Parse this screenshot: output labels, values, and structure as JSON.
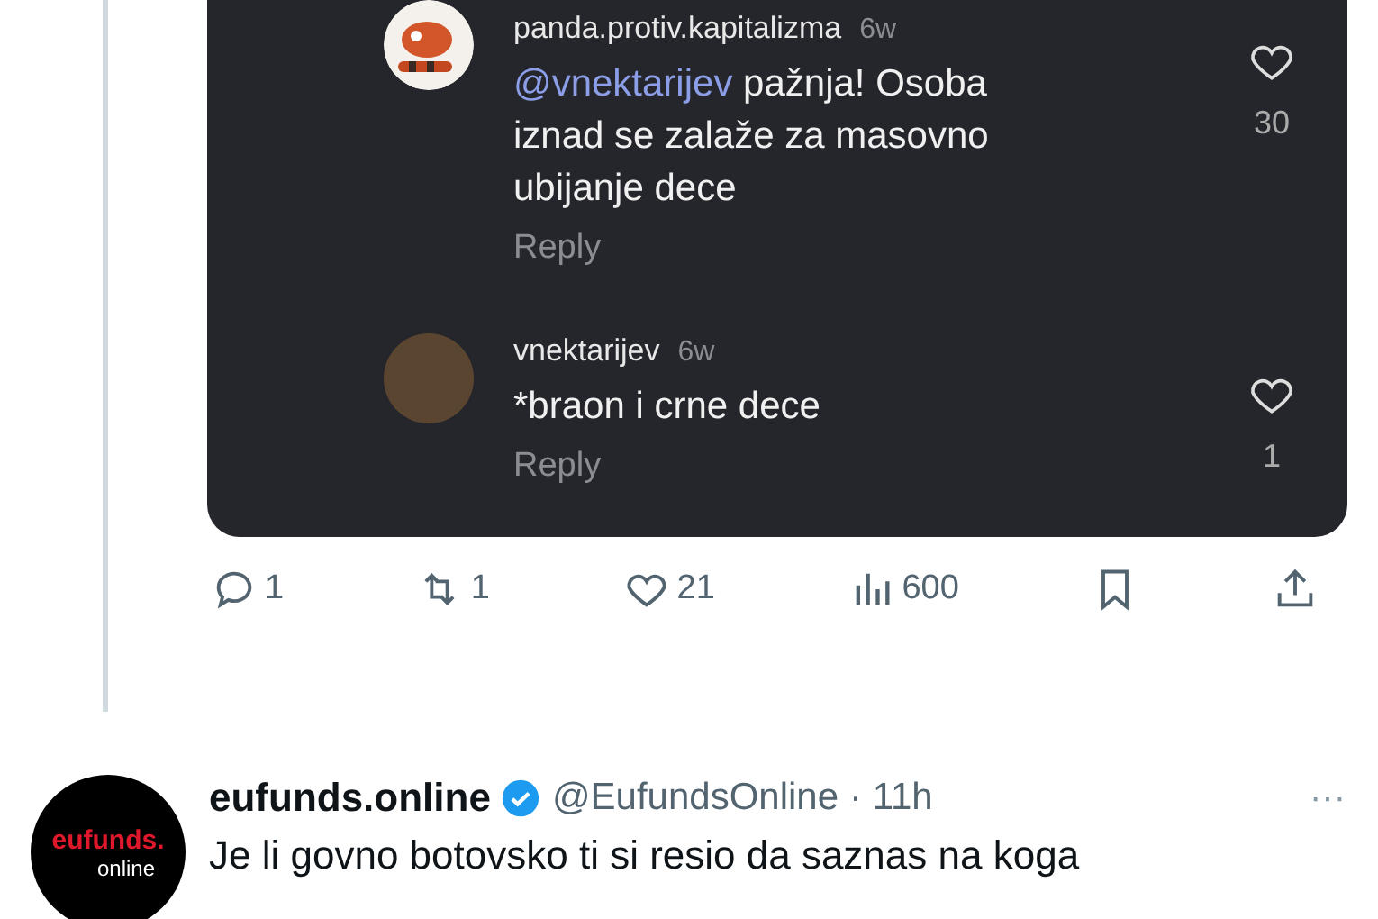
{
  "embedded_comments": [
    {
      "kind": "drawing",
      "username": "panda.protiv.kapitalizma",
      "time": "6w",
      "mention": "@vnektarijev",
      "text": "pažnja! Osoba iznad se zalaže za masovno ubijanje dece",
      "reply": "Reply",
      "likes": "30"
    },
    {
      "kind": "photo",
      "username": "vnektarijev",
      "time": "6w",
      "text": "*braon i crne dece",
      "reply": "Reply",
      "likes": "1"
    }
  ],
  "actions": [
    {
      "kind": "reply",
      "count": "1"
    },
    {
      "kind": "repost",
      "count": "1"
    },
    {
      "kind": "like",
      "count": "21"
    },
    {
      "kind": "views",
      "count": "600"
    },
    {
      "kind": "bookmark"
    },
    {
      "kind": "share"
    }
  ],
  "next_tweet": {
    "logo_top": "eufunds.",
    "logo_bottom": "online",
    "name": "eufunds.online",
    "verified": true,
    "handle": "@EufundsOnline",
    "time": "· 11h",
    "more": "···",
    "text": "Je li govno botovsko ti si resio da saznas na koga"
  }
}
